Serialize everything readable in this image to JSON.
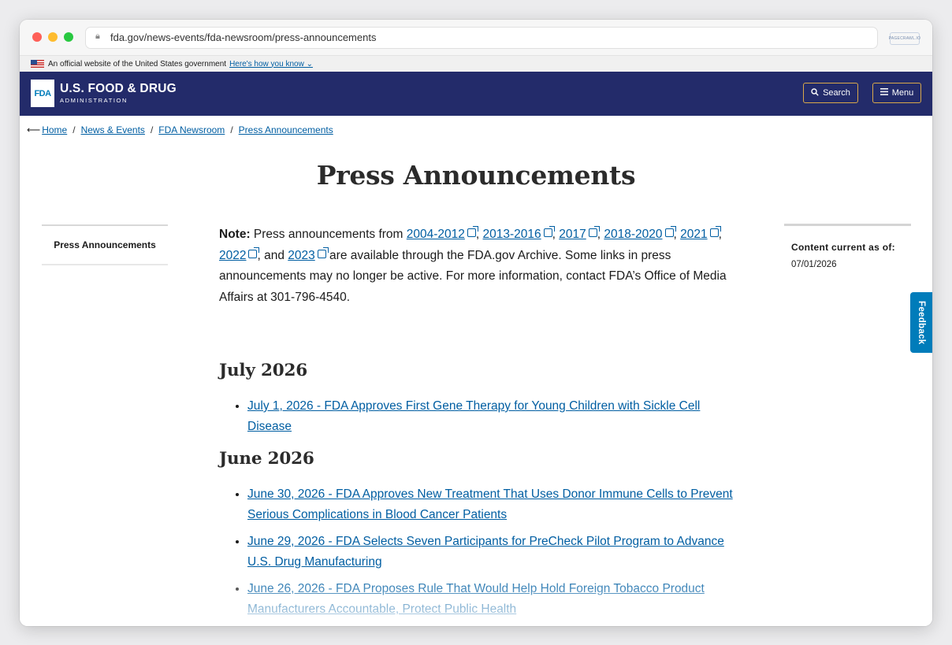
{
  "browser": {
    "url": "fda.gov/news-events/fda-newsroom/press-announcements",
    "extension_badge": "PAGECRAWL.IO"
  },
  "gov_banner": {
    "text": "An official website of the United States government",
    "link": "Here's how you know ⌄"
  },
  "header": {
    "logo_text": "FDA",
    "title": "U.S. FOOD & DRUG",
    "subtitle": "ADMINISTRATION",
    "search_label": "Search",
    "menu_label": "Menu",
    "search_icon": "search-icon",
    "menu_icon": "hamburger-icon"
  },
  "breadcrumb": [
    {
      "label": "Home"
    },
    {
      "label": "News & Events"
    },
    {
      "label": "FDA Newsroom"
    },
    {
      "label": "Press Announcements"
    }
  ],
  "page_title": "Press Announcements",
  "sidebar": {
    "item": "Press Announcements"
  },
  "content_current": {
    "label": "Content current as of:",
    "date": "07/01/2026"
  },
  "feedback_label": "Feedback",
  "note": {
    "prefix": "Note:",
    "text1": " Press announcements from ",
    "links": [
      "2004-2012",
      "2013-2016",
      "2017",
      "2018-2020",
      "2021",
      "2022",
      "2023"
    ],
    "text2": " are available through the FDA.gov Archive. Some links in press announcements may no longer be active. For more information, contact FDA’s Office of Media Affairs at 301-796-4540."
  },
  "sections": [
    {
      "month": "July 2026",
      "items": [
        "July 1, 2026 - FDA Approves First Gene Therapy for Young Children with Sickle Cell Disease"
      ]
    },
    {
      "month": "June 2026",
      "items": [
        "June 30, 2026 - FDA Approves New Treatment That Uses Donor Immune Cells to Prevent Serious Complications in Blood Cancer Patients",
        "June 29, 2026 - FDA Selects Seven Participants for PreCheck Pilot Program to Advance U.S. Drug Manufacturing",
        "June 26, 2026 - FDA Proposes Rule That Would Help Hold Foreign Tobacco Product Manufacturers Accountable, Protect Public Health"
      ]
    }
  ]
}
